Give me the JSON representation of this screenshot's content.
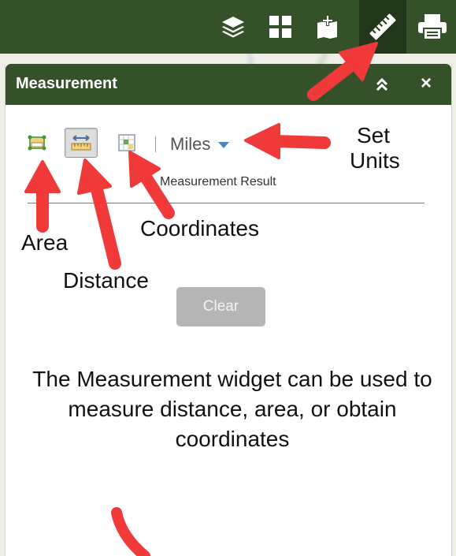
{
  "toolbar": {
    "tools": [
      {
        "icon": "layers-icon"
      },
      {
        "icon": "grid-icon"
      },
      {
        "icon": "add-data-icon"
      },
      {
        "icon": "ruler-icon",
        "active": true
      },
      {
        "icon": "print-icon"
      }
    ]
  },
  "panel": {
    "title": "Measurement",
    "close_label": "×",
    "measure_tools": [
      {
        "icon": "area-icon"
      },
      {
        "icon": "distance-icon",
        "selected": true
      },
      {
        "icon": "coordinates-icon"
      }
    ],
    "units": "Miles",
    "result_label": "Measurement Result",
    "clear_label": "Clear"
  },
  "annotations": {
    "set_units": "Set Units",
    "coordinates": "Coordinates",
    "area": "Area",
    "distance": "Distance",
    "description": "The Measurement widget can be used to measure distance, area, or obtain coordinates"
  },
  "colors": {
    "header_green": "#35512a",
    "active_tool": "#22361a",
    "arrow_red": "#f03a3a",
    "units_caret": "#4a86c5"
  }
}
